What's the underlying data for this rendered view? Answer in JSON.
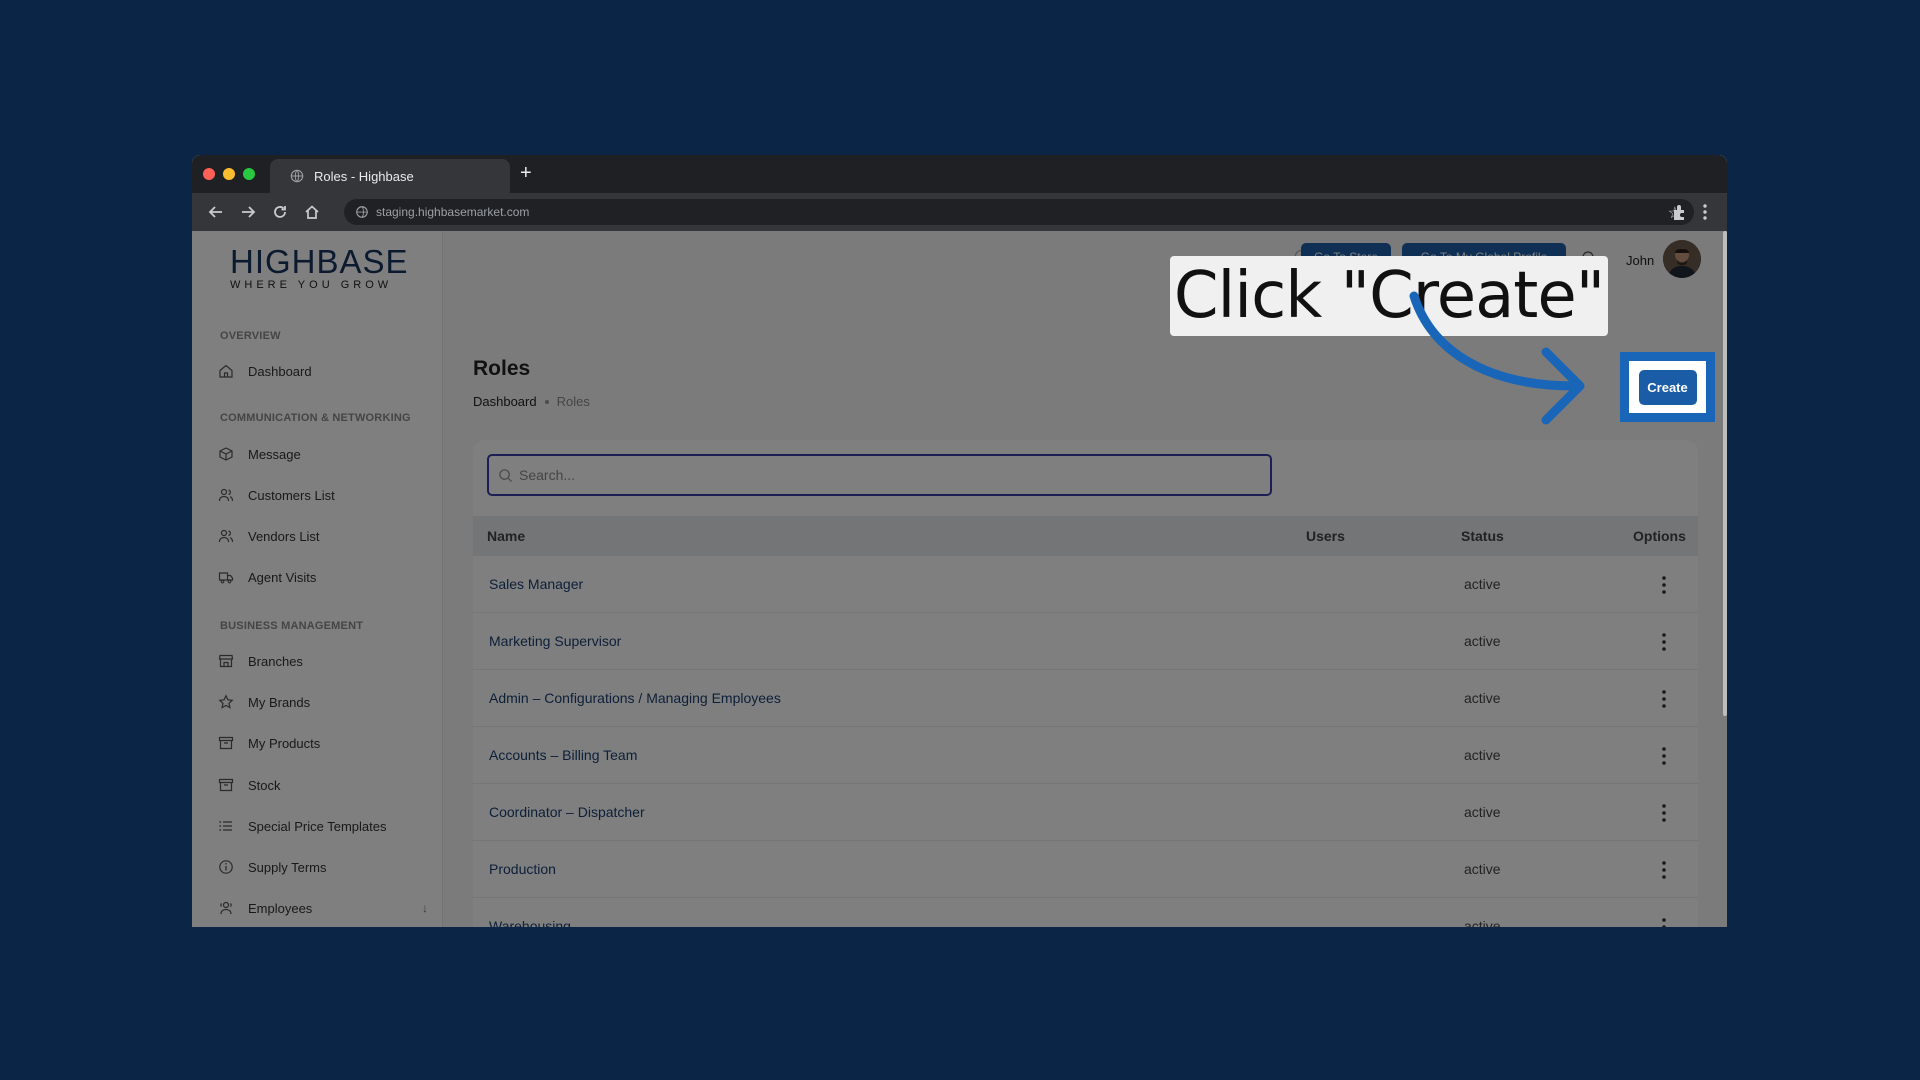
{
  "browser": {
    "tab_title": "Roles - Highbase",
    "new_tab": "+",
    "url": "staging.highbasemarket.com"
  },
  "logo": {
    "name": "HIGHBASE",
    "tagline": "WHERE YOU GROW"
  },
  "sidebar": {
    "sections": {
      "overview": "OVERVIEW",
      "communication": "COMMUNICATION & NETWORKING",
      "business": "BUSINESS MANAGEMENT"
    },
    "items": [
      {
        "label": "Dashboard",
        "icon": "home-icon"
      },
      {
        "label": "Message",
        "icon": "message-icon"
      },
      {
        "label": "Customers List",
        "icon": "users-icon"
      },
      {
        "label": "Vendors List",
        "icon": "users-icon"
      },
      {
        "label": "Agent Visits",
        "icon": "truck-icon"
      },
      {
        "label": "Branches",
        "icon": "store-icon"
      },
      {
        "label": "My Brands",
        "icon": "star-icon"
      },
      {
        "label": "My Products",
        "icon": "box-icon"
      },
      {
        "label": "Stock",
        "icon": "box-icon"
      },
      {
        "label": "Special Price Templates",
        "icon": "list-icon"
      },
      {
        "label": "Supply Terms",
        "icon": "info-icon"
      },
      {
        "label": "Employees",
        "icon": "employees-icon",
        "arrow": "↓"
      }
    ]
  },
  "header": {
    "go_to_store": "Go To Store",
    "go_to_profile": "Go To My Global Profile",
    "user_name": "John"
  },
  "page": {
    "title": "Roles",
    "breadcrumb": [
      "Dashboard",
      "Roles"
    ],
    "create_label": "Create"
  },
  "search": {
    "placeholder": "Search..."
  },
  "table": {
    "columns": [
      "Name",
      "Users",
      "Status",
      "Options"
    ],
    "rows": [
      {
        "name": "Sales Manager",
        "status": "active"
      },
      {
        "name": "Marketing Supervisor",
        "status": "active"
      },
      {
        "name": "Admin – Configurations / Managing Employees",
        "status": "active"
      },
      {
        "name": "Accounts – Billing Team",
        "status": "active"
      },
      {
        "name": "Coordinator – Dispatcher",
        "status": "active"
      },
      {
        "name": "Production",
        "status": "active"
      },
      {
        "name": "Warehousing",
        "status": "active"
      }
    ]
  },
  "callout": {
    "text": "Click \"Create\""
  },
  "colors": {
    "background": "#0b2547",
    "accent": "#1966b8",
    "button": "#1a5da6"
  }
}
